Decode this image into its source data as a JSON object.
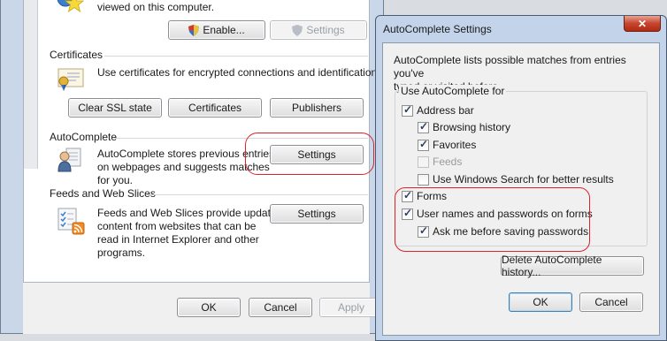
{
  "internet_options": {
    "top_text": "viewed on this computer.",
    "enable_label": "Enable...",
    "settings_top_label": "Settings",
    "certificates": {
      "title": "Certificates",
      "description": "Use certificates for encrypted connections and identification.",
      "buttons": [
        "Clear SSL state",
        "Certificates",
        "Publishers"
      ]
    },
    "autocomplete": {
      "title": "AutoComplete",
      "description_lines": [
        "AutoComplete stores previous entries",
        "on webpages and suggests matches",
        "for you."
      ],
      "settings_label": "Settings"
    },
    "feeds": {
      "title": "Feeds and Web Slices",
      "description_lines": [
        "Feeds and Web Slices provide updated",
        "content from websites that can be",
        "read in Internet Explorer and other",
        "programs."
      ],
      "settings_label": "Settings"
    },
    "footer": {
      "ok": "OK",
      "cancel": "Cancel",
      "apply": "Apply"
    }
  },
  "autocomplete_dialog": {
    "title": "AutoComplete Settings",
    "close_glyph": "✕",
    "intro_lines": [
      "AutoComplete lists possible matches from entries you've",
      "typed or visited before."
    ],
    "group_label": "Use AutoComplete for",
    "options": [
      {
        "label": "Address bar",
        "checked": true,
        "enabled": true
      },
      {
        "label": "Browsing history",
        "checked": true,
        "enabled": true
      },
      {
        "label": "Favorites",
        "checked": true,
        "enabled": true
      },
      {
        "label": "Feeds",
        "checked": false,
        "enabled": false
      },
      {
        "label": "Use Windows Search for better results",
        "checked": false,
        "enabled": true
      },
      {
        "label": "Forms",
        "checked": true,
        "enabled": true
      },
      {
        "label": "User names and passwords on forms",
        "checked": true,
        "enabled": true
      },
      {
        "label": "Ask me before saving passwords",
        "checked": true,
        "enabled": true
      }
    ],
    "delete_history_label": "Delete AutoComplete history...",
    "ok": "OK",
    "cancel": "Cancel"
  },
  "colors": {
    "annotation_ring": "#d9252a",
    "window_frame": "#c3d4ea"
  }
}
